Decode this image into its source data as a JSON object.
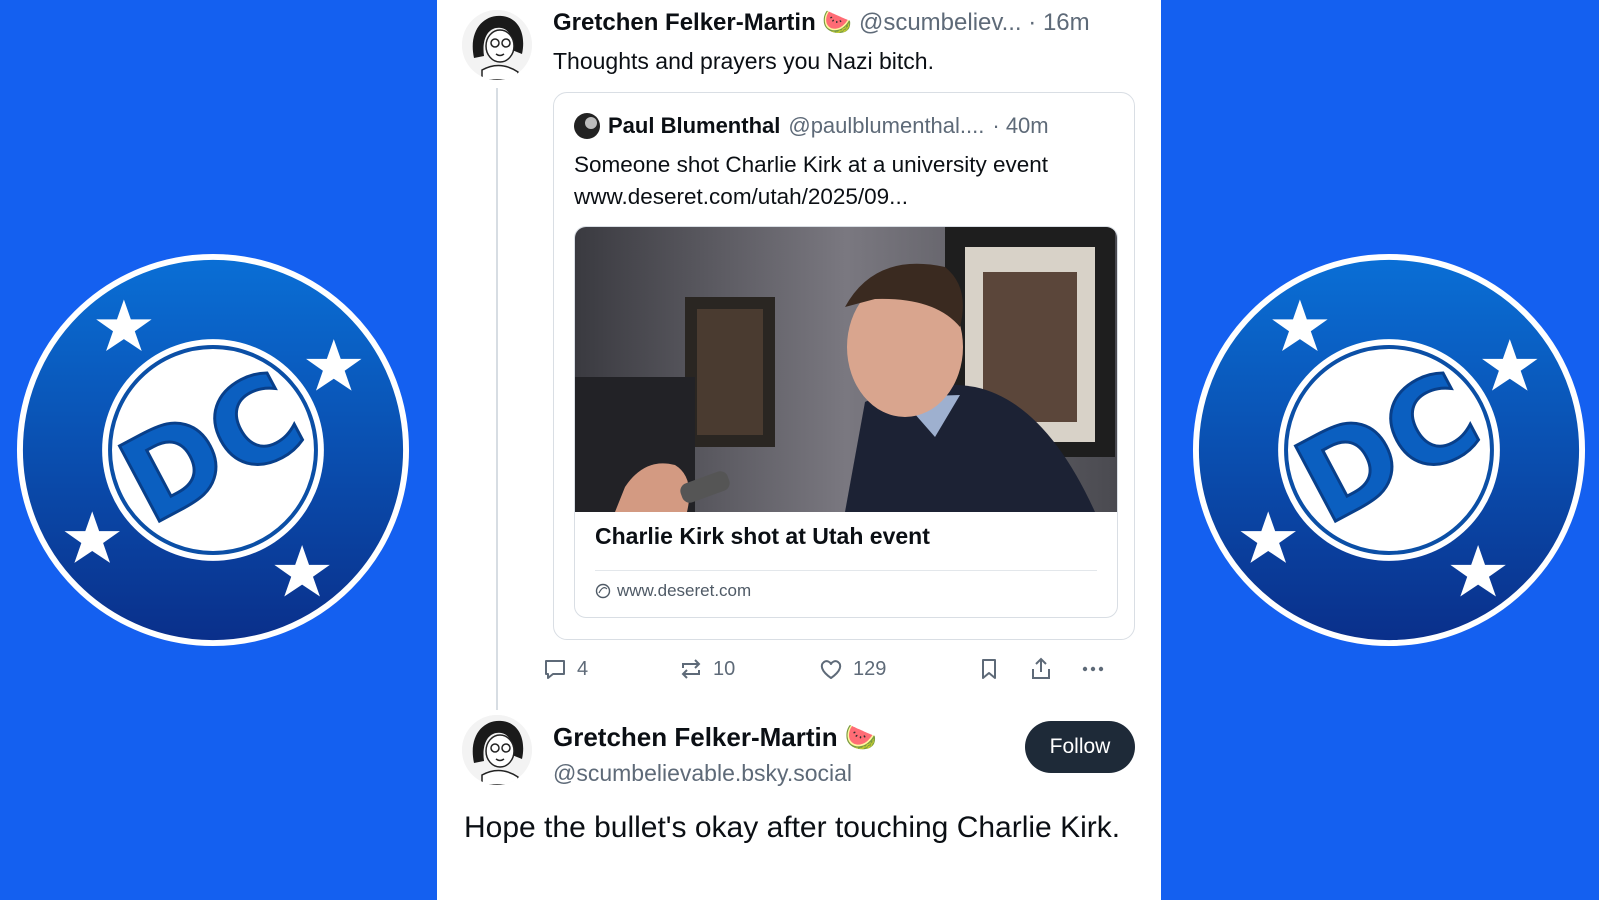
{
  "background_color": "#1460f0",
  "logos": {
    "left": {
      "icon": "dc-logo-icon",
      "text": "DC"
    },
    "right": {
      "icon": "dc-logo-icon",
      "text": "DC"
    }
  },
  "post1": {
    "author_name": "Gretchen Felker-Martin",
    "author_emoji": "🍉",
    "handle": "@scumbeliev...",
    "time": "· 16m",
    "text": "Thoughts and prayers you Nazi bitch.",
    "quote": {
      "author_name": "Paul Blumenthal",
      "handle": "@paulblumenthal....",
      "time": "· 40m",
      "text": "Someone shot Charlie Kirk at a university event www.deseret.com/utah/2025/09...",
      "card": {
        "title": "Charlie Kirk shot at Utah event",
        "domain": "www.deseret.com",
        "image": "man-speaking-photo"
      }
    },
    "actions": {
      "replies": "4",
      "reposts": "10",
      "likes": "129"
    }
  },
  "post2": {
    "author_name": "Gretchen Felker-Martin",
    "author_emoji": "🍉",
    "handle": "@scumbelievable.bsky.social",
    "follow_label": "Follow",
    "text": "Hope the bullet's okay after touching Charlie Kirk."
  }
}
